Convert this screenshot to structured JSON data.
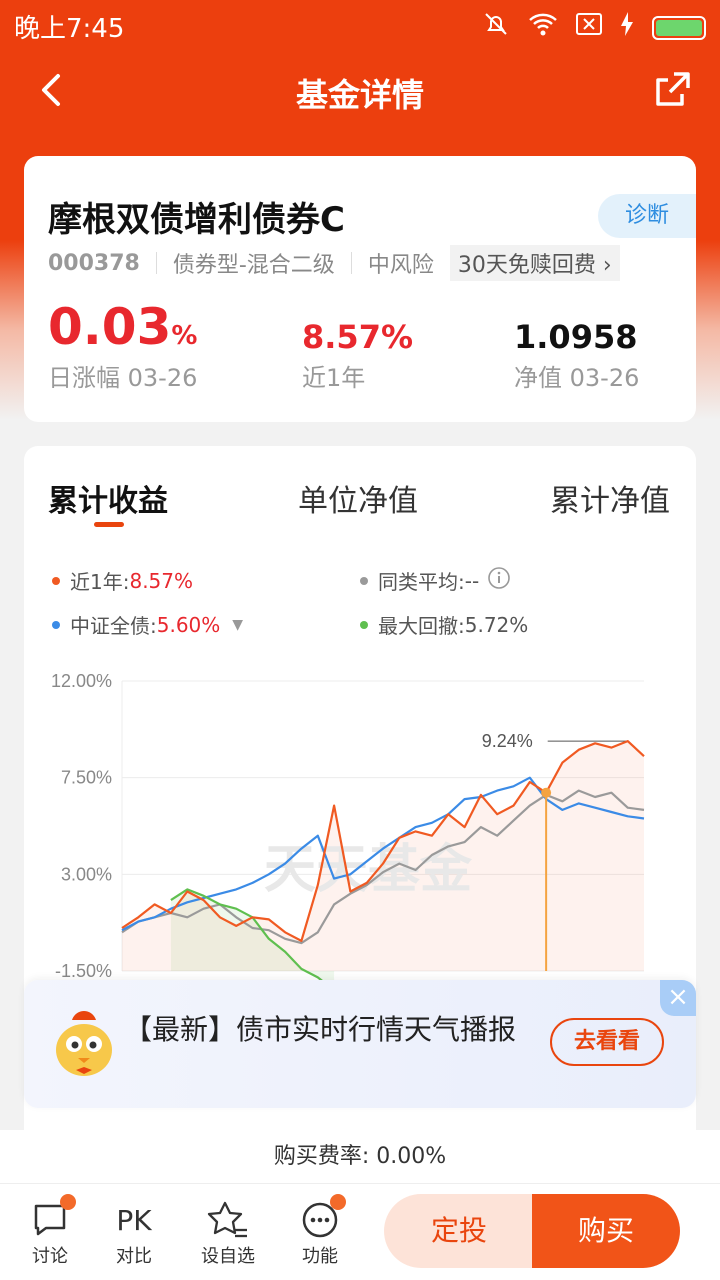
{
  "status_bar": {
    "time": "晚上7:45"
  },
  "header": {
    "title": "基金详情"
  },
  "fund": {
    "name": "摩根双债增利债券C",
    "diagnose_label": "诊断",
    "code": "000378",
    "type": "债券型-混合二级",
    "risk": "中风险",
    "promo": "30天免赎回费 ›",
    "daily_change": "0.03",
    "daily_change_unit": "%",
    "daily_change_label": "日涨幅 03-26",
    "year_return": "8.57%",
    "year_return_label": "近1年",
    "nav": "1.0958",
    "nav_label": "净值 03-26"
  },
  "chart_tabs": [
    "累计收益",
    "单位净值",
    "累计净值"
  ],
  "legend": {
    "fund_label": "近1年:",
    "fund_value": "8.57%",
    "peer_label": "同类平均:",
    "peer_value": "--",
    "index_label": "中证全债:",
    "index_value": "5.60%",
    "drawdown_label": "最大回撤:",
    "drawdown_value": "5.72%"
  },
  "colors": {
    "fund": "#f05a22",
    "index": "#3b8be6",
    "peer": "#9a9a9a",
    "drawdown": "#5fbf4f"
  },
  "chart_data": {
    "type": "line",
    "yticks": [
      "12.00%",
      "7.50%",
      "3.00%",
      "-1.50%"
    ],
    "ylim": [
      -1.5,
      12
    ],
    "max_annotation": "9.24%",
    "watermark": "天天基金",
    "series": [
      {
        "name": "近1年",
        "values": [
          0.5,
          1.0,
          1.6,
          1.2,
          2.2,
          1.8,
          1.0,
          0.6,
          1.0,
          0.9,
          0.3,
          -0.1,
          2.5,
          6.2,
          2.2,
          2.6,
          3.5,
          4.7,
          5.0,
          4.8,
          5.8,
          5.2,
          6.7,
          5.8,
          6.2,
          7.3,
          6.8,
          8.2,
          8.8,
          9.1,
          8.9,
          9.2,
          8.5
        ]
      },
      {
        "name": "中证全债",
        "values": [
          0.4,
          0.8,
          1.0,
          1.4,
          1.7,
          1.9,
          2.1,
          2.3,
          2.6,
          3.0,
          3.5,
          4.2,
          4.8,
          2.8,
          3.0,
          3.6,
          4.2,
          4.7,
          5.2,
          5.4,
          5.8,
          6.5,
          6.6,
          6.9,
          7.1,
          7.5,
          6.5,
          6.0,
          6.3,
          6.1,
          5.9,
          5.7,
          5.6
        ]
      },
      {
        "name": "同类平均",
        "values": [
          0.3,
          0.8,
          1.0,
          1.2,
          1.0,
          1.4,
          1.6,
          1.0,
          0.5,
          0.4,
          0.0,
          -0.2,
          0.3,
          1.6,
          2.1,
          2.5,
          3.1,
          3.5,
          3.2,
          3.9,
          4.3,
          4.5,
          5.2,
          4.8,
          5.5,
          6.2,
          6.7,
          6.4,
          6.9,
          6.6,
          6.8,
          6.1,
          6.0
        ]
      },
      {
        "name": "最大回撤",
        "values": [
          1.8,
          2.3,
          2.0,
          1.6,
          1.4,
          1.0,
          0.0,
          -0.6,
          -1.4,
          -1.8,
          -2.4
        ]
      }
    ]
  },
  "banner": {
    "text": "【最新】债市实时行情天气播报",
    "button": "去看看",
    "close": "×"
  },
  "fee": {
    "text": "购买费率: 0.00%"
  },
  "bottom_nav": {
    "items": [
      {
        "label": "讨论"
      },
      {
        "label": "对比",
        "icon_text": "PK"
      },
      {
        "label": "设自选"
      },
      {
        "label": "功能"
      }
    ],
    "invest_label": "定投",
    "buy_label": "购买"
  }
}
